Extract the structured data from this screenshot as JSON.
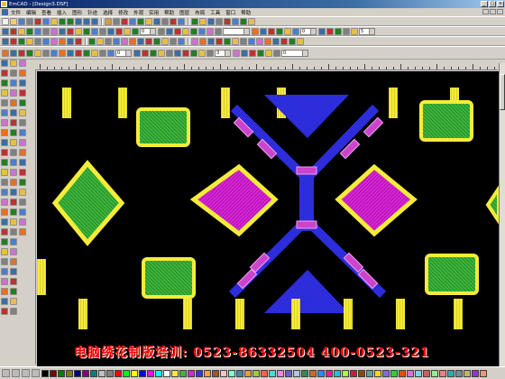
{
  "window": {
    "title": "EmCAD - [Design3.DSF]",
    "controls": [
      "_",
      "□",
      "×"
    ]
  },
  "menu": {
    "items": [
      "文件",
      "编辑",
      "查看",
      "插入",
      "图形",
      "针迹",
      "选择",
      "修改",
      "外观",
      "实用",
      "帮助",
      "图层",
      "布局",
      "工具",
      "窗口",
      "帮助"
    ]
  },
  "toolbar1": {
    "icons": [
      "new-icon",
      "open-icon",
      "save-icon",
      "print-icon",
      "cut-icon",
      "copy-icon",
      "paste-icon",
      "undo-icon",
      "redo-icon",
      "zoom-in-icon",
      "zoom-out-icon",
      "zoom-fit-icon"
    ]
  },
  "toolbar2": {
    "combo1_value": "0",
    "combo2_value": "",
    "combo3_value": "0",
    "combo4_value": "5"
  },
  "toolbar3": {
    "combo1_value": "0",
    "combo2_value": "3",
    "combo3_value": "0"
  },
  "watermark": {
    "text": "电脑绣花制版培训: 0523-86332504  400-0523-321"
  },
  "design": {
    "background_color": "#000000",
    "colors": {
      "yellow": "#f5ec3a",
      "green": "#3cb53c",
      "magenta": "#dd22dd",
      "blue": "#3333ee",
      "violet": "#cc44cc"
    }
  },
  "palette": {
    "colors": [
      "#000000",
      "#800000",
      "#008000",
      "#808000",
      "#000080",
      "#800080",
      "#008080",
      "#c0c0c0",
      "#808080",
      "#ff0000",
      "#00ff00",
      "#ffff00",
      "#0000ff",
      "#ff00ff",
      "#00ffff",
      "#ffffff",
      "#f5ec3a",
      "#3cb53c",
      "#dd22dd",
      "#3333ee",
      "#ffa040",
      "#a0522d",
      "#ffc0cb",
      "#7fffd4",
      "#4682b4",
      "#daa520",
      "#9acd32",
      "#ff6347",
      "#40e0d0",
      "#ee82ee",
      "#6a5acd",
      "#b0c4de",
      "#2e8b57",
      "#d2691e",
      "#1e90ff",
      "#ff1493",
      "#00ced1",
      "#adff2f",
      "#dc143c",
      "#8b4513",
      "#5f9ea0",
      "#ffd700",
      "#7b68ee",
      "#32cd32",
      "#ff4500",
      "#da70d6",
      "#87ceeb",
      "#cd5c5c",
      "#90ee90",
      "#f08080",
      "#20b2aa",
      "#778899",
      "#bdb76b",
      "#9932cc",
      "#e9967a"
    ]
  }
}
